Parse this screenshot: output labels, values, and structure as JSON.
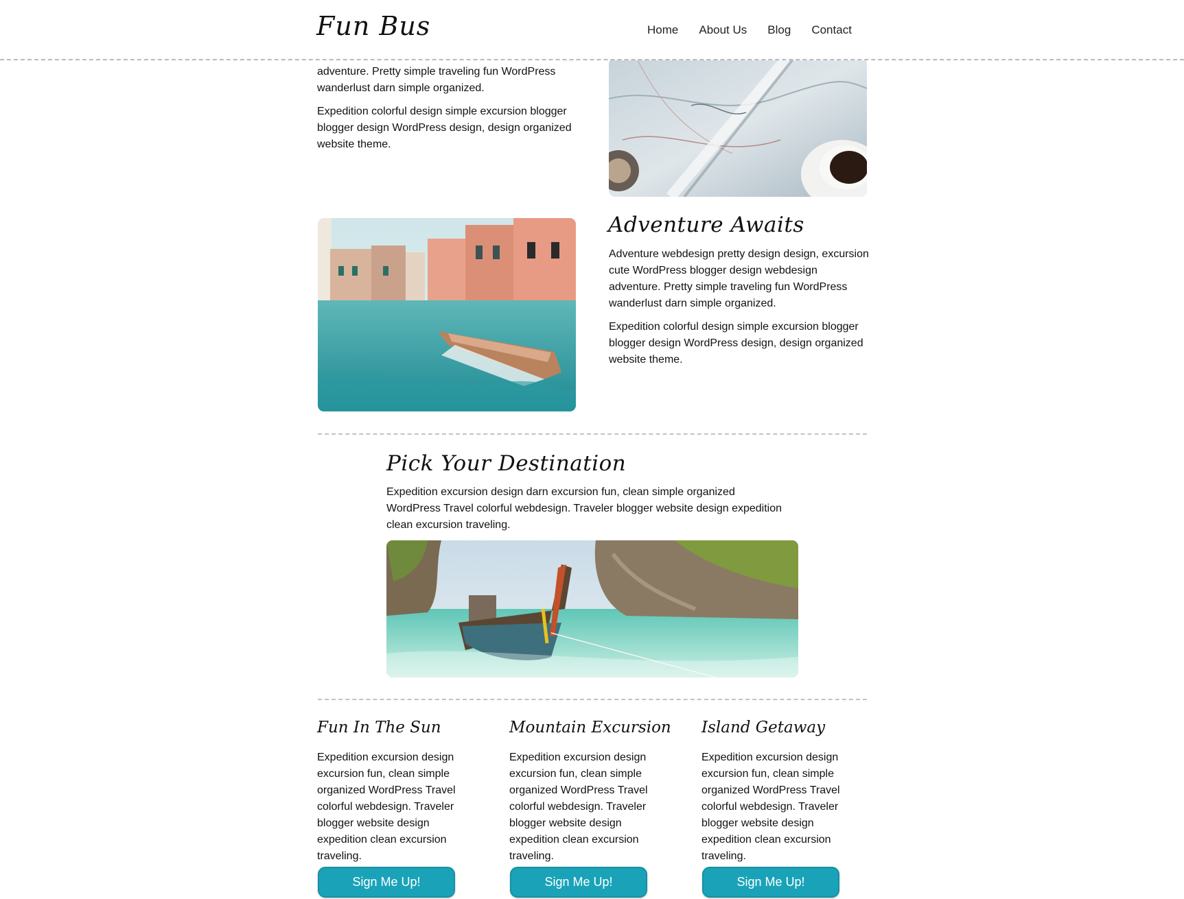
{
  "header": {
    "logo": "Fun Bus",
    "nav": [
      "Home",
      "About Us",
      "Blog",
      "Contact"
    ]
  },
  "section_top": {
    "paragraphs": [
      "adventure. Pretty simple traveling fun WordPress wanderlust darn simple organized.",
      "Expedition colorful design simple excursion blogger blogger design WordPress design, design organized website theme."
    ]
  },
  "adventure": {
    "title": "Adventure Awaits",
    "paragraphs": [
      "Adventure webdesign pretty design design, excursion cute WordPress blogger design webdesign adventure. Pretty simple traveling fun WordPress wanderlust darn simple organized.",
      "Expedition colorful design simple excursion blogger blogger design WordPress design, design organized website theme."
    ]
  },
  "destination": {
    "title": "Pick Your Destination",
    "paragraph": "Expedition excursion design darn excursion fun, clean simple organized WordPress Travel colorful webdesign. Traveler blogger website design expedition clean excursion traveling."
  },
  "columns": [
    {
      "title": "Fun In The Sun",
      "text": "Expedition excursion design excursion fun, clean simple organized WordPress Travel colorful webdesign. Traveler blogger website design expedition clean excursion traveling.",
      "button": "Sign Me Up!"
    },
    {
      "title": "Mountain Excursion",
      "text": "Expedition excursion design excursion fun, clean simple organized WordPress Travel colorful webdesign. Traveler blogger website design expedition clean excursion traveling.",
      "button": "Sign Me Up!"
    },
    {
      "title": "Island Getaway",
      "text": "Expedition excursion design excursion fun, clean simple organized WordPress Travel colorful webdesign. Traveler blogger website design expedition clean excursion traveling.",
      "button": "Sign Me Up!"
    }
  ],
  "colors": {
    "button": "#1aa3b8",
    "divider": "#c2c2c2"
  },
  "images": [
    "map-with-coffee-photo",
    "venice-canal-boat-photo",
    "thai-longtail-boat-beach-photo"
  ]
}
